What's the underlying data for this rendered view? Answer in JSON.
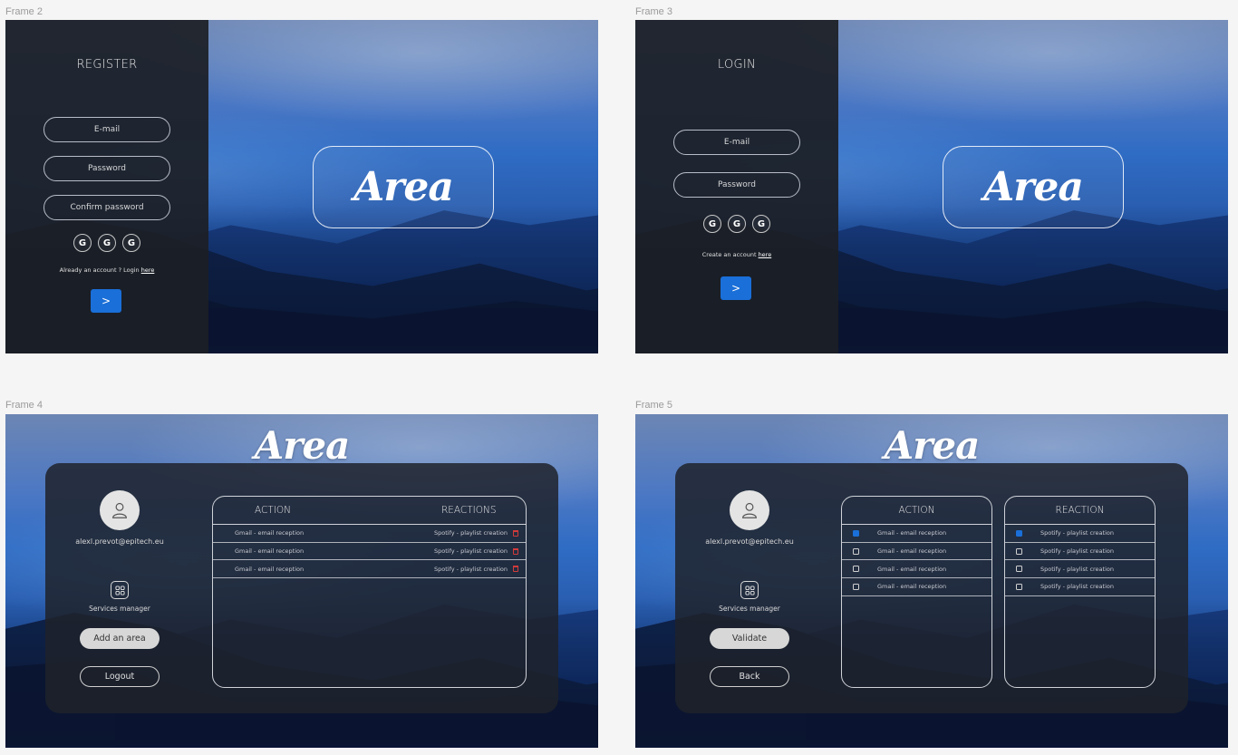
{
  "frames": {
    "f2": {
      "label": "Frame 2",
      "title": "REGISTER",
      "email_placeholder": "E-mail",
      "password_placeholder": "Password",
      "confirm_placeholder": "Confirm password",
      "social": [
        "G",
        "G",
        "G"
      ],
      "footer_text": "Already an account ? Login ",
      "footer_link": "here",
      "submit_icon": ">",
      "logo": "Area"
    },
    "f3": {
      "label": "Frame 3",
      "title": "LOGIN",
      "email_placeholder": "E-mail",
      "password_placeholder": "Password",
      "social": [
        "G",
        "G",
        "G"
      ],
      "footer_text": "Create an account ",
      "footer_link": "here",
      "submit_icon": ">",
      "logo": "Area"
    },
    "f4": {
      "label": "Frame 4",
      "logo": "Area",
      "user_email": "alexl.prevot@epitech.eu",
      "services_label": "Services manager",
      "primary_button": "Add an area",
      "secondary_button": "Logout",
      "col_action": "ACTION",
      "col_reactions": "REACTIONS",
      "rows": [
        {
          "action": "Gmail - email reception",
          "reaction": "Spotify - playlist creation"
        },
        {
          "action": "Gmail - email reception",
          "reaction": "Spotify - playlist creation"
        },
        {
          "action": "Gmail - email reception",
          "reaction": "Spotify - playlist creation"
        }
      ]
    },
    "f5": {
      "label": "Frame 5",
      "logo": "Area",
      "user_email": "alexl.prevot@epitech.eu",
      "services_label": "Services manager",
      "primary_button": "Validate",
      "secondary_button": "Back",
      "action_title": "ACTION",
      "reaction_title": "REACTION",
      "actions": [
        {
          "label": "Gmail - email reception",
          "checked": true
        },
        {
          "label": "Gmail - email reception",
          "checked": false
        },
        {
          "label": "Gmail - email reception",
          "checked": false
        },
        {
          "label": "Gmail - email reception",
          "checked": false
        }
      ],
      "reactions": [
        {
          "label": "Spotify - playlist creation",
          "checked": true
        },
        {
          "label": "Spotify - playlist creation",
          "checked": false
        },
        {
          "label": "Spotify - playlist creation",
          "checked": false
        },
        {
          "label": "Spotify - playlist creation",
          "checked": false
        }
      ]
    }
  },
  "colors": {
    "accent": "#1a6fd8",
    "panel": "#1c1f26",
    "delete": "#d23b3b"
  }
}
